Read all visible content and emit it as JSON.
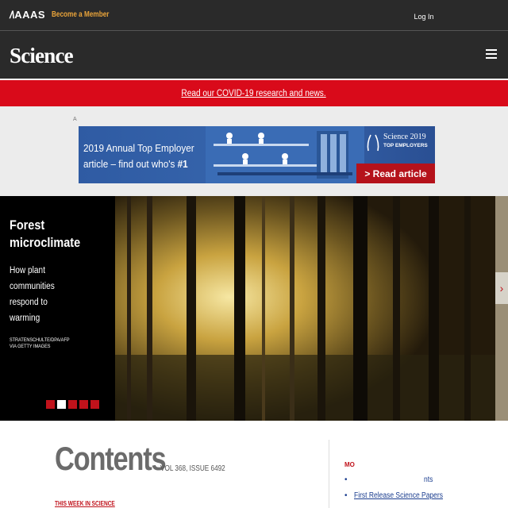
{
  "header": {
    "aaas_logo": "AAAS",
    "become_member": "Become a Member",
    "login_label": "Log In"
  },
  "nav": {
    "brand": "Science"
  },
  "banner": {
    "covid_text": "Read our COVID-19 research and news."
  },
  "ad": {
    "label": "A",
    "line1": "2019 Annual Top Employer",
    "line2": "article – find out who's ",
    "line2_bold": "#1",
    "brand_line1": "Science 2019",
    "brand_line2": "TOP EMPLOYERS",
    "cta": "> Read article"
  },
  "hero": {
    "title_line1": "Forest",
    "title_line2": "microclimate",
    "description": "How plant communities respond to warming",
    "credit": "STRATENSCHULTE/DPA/AFP VIA GETTY IMAGES",
    "next_arrow": "›"
  },
  "contents": {
    "title": "Contents",
    "issue": "VOL 368, ISSUE 6492",
    "this_week": "THIS WEEK IN SCIENCE"
  },
  "sidebar_links": {
    "heading": "MO",
    "item1": "nts",
    "item2": "First Release Science Papers"
  }
}
